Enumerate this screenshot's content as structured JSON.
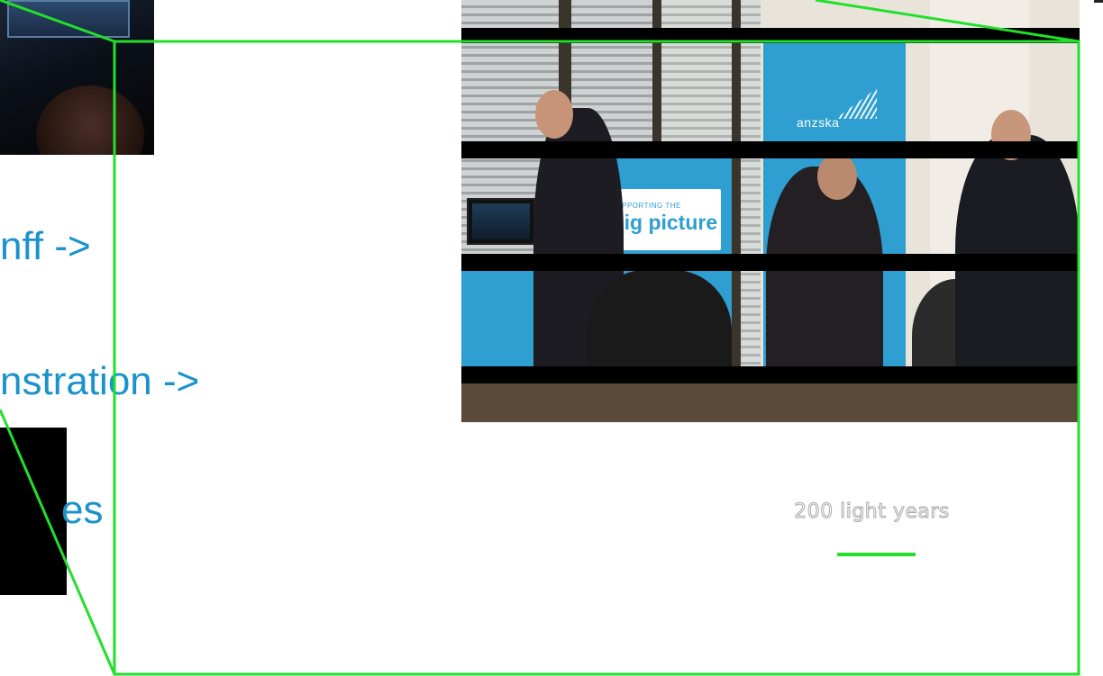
{
  "links": {
    "item1": "nff ->",
    "item2": "nstration ->",
    "item3": "es"
  },
  "photo": {
    "banner_small": "SUPPORTING THE",
    "banner_big": "Big picture",
    "logo": "anzska"
  },
  "caption": {
    "text": "200 light years"
  },
  "colors": {
    "link": "#1a93cb",
    "overlay_line": "#22e02a",
    "banner": "#2e9fd0"
  }
}
